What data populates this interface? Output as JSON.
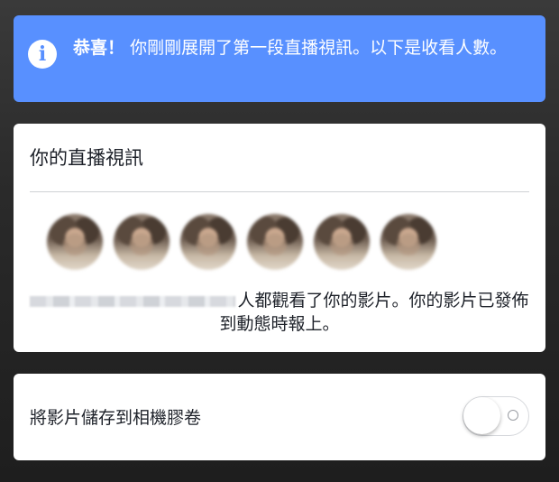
{
  "banner": {
    "icon": "info-icon",
    "icon_glyph": "i",
    "strong": "恭喜！",
    "message": "你剛剛展開了第一段直播視訊。以下是收看人數。",
    "color": "#5890ff"
  },
  "live_card": {
    "title": "你的直播視訊",
    "viewers_text": "人都觀看了你的影片。你的影片已發佈到動態時報上。",
    "avatar_count": 6
  },
  "save_card": {
    "label": "將影片儲存到相機膠卷",
    "toggle_on": false
  }
}
